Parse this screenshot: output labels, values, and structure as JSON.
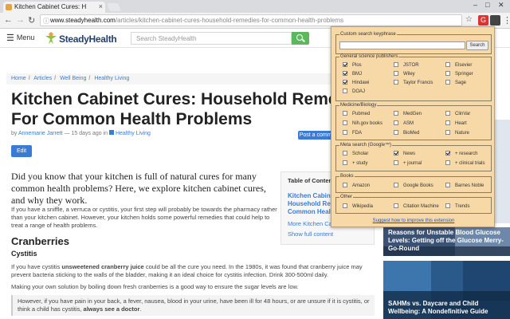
{
  "browser": {
    "tab_title": "Kitchen Cabinet Cures: H",
    "tab_close": "×",
    "url_host": "www.steadyhealth.com",
    "url_path": "/articles/kitchen-cabinet-cures-household-remedies-for-common-health-problems",
    "win_min": "–",
    "win_max": "□",
    "win_close": "✕",
    "back": "←",
    "forward": "→",
    "reload": "↻",
    "lock": "ⓘ",
    "star": "☆",
    "ext_label": "G",
    "menu_dots": "⋮"
  },
  "header": {
    "menu_label": "Menu",
    "menu_icon": "☰",
    "logo_text": "SteadyHealth",
    "search_placeholder": "Search SteadyHealth"
  },
  "breadcrumb": [
    "Home",
    "Articles",
    "Well Being",
    "Healthy Living"
  ],
  "article": {
    "title": "Kitchen Cabinet Cures: Household Remedies For Common Health Problems",
    "by": "by",
    "author": "Annemarie Jarrett",
    "ago": "— 15 days ago in",
    "category": "Healthy Living",
    "comment_button": "Post a comment",
    "edit_button": "Edit",
    "lead": "Did you know that your kitchen is full of natural cures for many common health problems? Here, we explore kitchen cabinet cures, and why they work.",
    "intro": "If you have a sniffle, a verruca or cystitis, your first step will probably be towards the pharmacy rather than your kitchen cabinet. However, your kitchen holds some powerful remedies that could help to treat a range of health problems.",
    "h2": "Cranberries",
    "h3": "Cystitis",
    "p1_before": "If you have cystitis ",
    "p1_bold": "unsweetened cranberry juice",
    "p1_after": " could be all the cure you need. In the 1980s, it was found that cranberry juice may prevent bacteria sticking to the walls of the bladder, making it an ideal choice for cystitis infection. Drink 300-500ml daily.",
    "p2": "Making your own solution by boiling down fresh cranberries is a good way to ensure the sugar levels are low.",
    "callout_before": "However, if you have pain in your back, a fever, nausea, blood in your urine, have been ill for 48 hours, or are unsure if it is cystitis, or think a child has cystitis, ",
    "callout_bold": "always see a doctor",
    "callout_after": "."
  },
  "toc": {
    "title": "Table of Contents",
    "link": "Kitchen Cabinet Cures: Household Remedies For Common Health Problems",
    "more": "More Kitchen Cabinet Cures",
    "show_all": "Show full content"
  },
  "sidebar": {
    "card1": "Reasons for Unstable Blood Glucose Levels: Getting off the Glucose Merry-Go-Round",
    "card2": "SAHMs vs. Daycare and Child Wellbeing: A Nondefinitive Guide"
  },
  "popup": {
    "keyphrase_legend": "Custom search keyphrase",
    "search_button": "Search",
    "general_legend": "General science publishers",
    "general_options": [
      {
        "label": "Plos",
        "checked": true
      },
      {
        "label": "JSTOR",
        "checked": false
      },
      {
        "label": "Elsevier",
        "checked": false
      },
      {
        "label": "BMJ",
        "checked": true
      },
      {
        "label": "Wiley",
        "checked": false
      },
      {
        "label": "Springer",
        "checked": false
      },
      {
        "label": "Hindawi",
        "checked": true
      },
      {
        "label": "Taylor Francis",
        "checked": false
      },
      {
        "label": "Sage",
        "checked": false
      },
      {
        "label": "DOAJ",
        "checked": false
      }
    ],
    "medicine_legend": "Medicine/Biology",
    "medicine_options": [
      {
        "label": "Pubmed",
        "checked": false
      },
      {
        "label": "MedGen",
        "checked": false
      },
      {
        "label": "ClinVar",
        "checked": false
      },
      {
        "label": "Nih.gov books",
        "checked": false
      },
      {
        "label": "ASM",
        "checked": false
      },
      {
        "label": "Heart",
        "checked": false
      },
      {
        "label": "FDA",
        "checked": false
      },
      {
        "label": "BioMed",
        "checked": false
      },
      {
        "label": "Nature",
        "checked": false
      }
    ],
    "meta_legend": "Meta search (Google™)",
    "meta_options": [
      {
        "label": "Scholar",
        "checked": false
      },
      {
        "label": "News",
        "checked": true
      },
      {
        "label": "+ research",
        "checked": true
      },
      {
        "label": "+ study",
        "checked": false
      },
      {
        "label": "+ journal",
        "checked": false
      },
      {
        "label": "+ clinical trials",
        "checked": false
      }
    ],
    "books_legend": "Books",
    "books_options": [
      {
        "label": "Amazon",
        "checked": false
      },
      {
        "label": "Google Books",
        "checked": false
      },
      {
        "label": "Barnes Noble",
        "checked": false
      }
    ],
    "other_legend": "Other",
    "other_options": [
      {
        "label": "Wikipedia",
        "checked": false
      },
      {
        "label": "Citation Machine",
        "checked": false
      },
      {
        "label": "Trends",
        "checked": false
      }
    ],
    "suggest_link": "Suggest how to improve this extension"
  },
  "colors": {
    "accent": "#3a7bd5",
    "popup_bg": "#f7d9a8",
    "search_green": "#5cb85c"
  }
}
